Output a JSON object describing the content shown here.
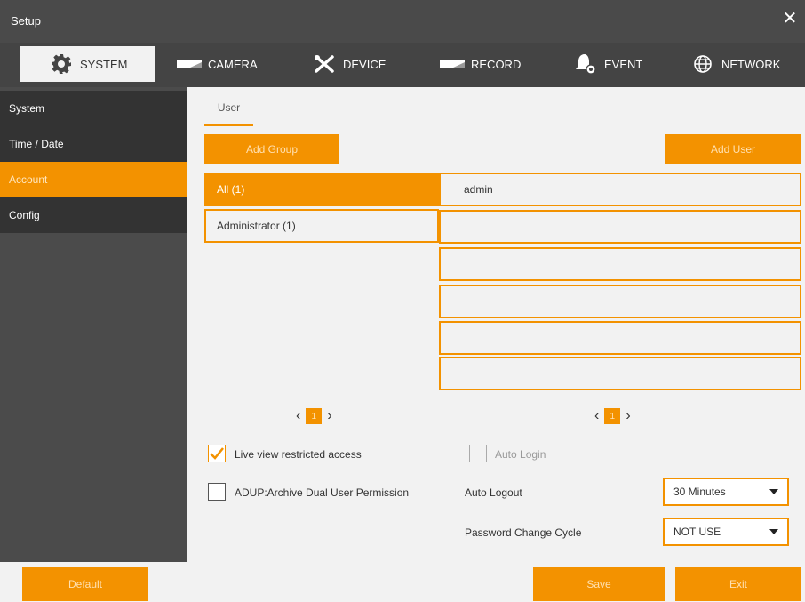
{
  "window": {
    "title": "Setup",
    "close_label": "✕"
  },
  "tabs": [
    {
      "label": "SYSTEM",
      "icon": "gear-icon",
      "active": true
    },
    {
      "label": "CAMERA",
      "icon": "camera-icon",
      "active": false
    },
    {
      "label": "DEVICE",
      "icon": "tools-icon",
      "active": false
    },
    {
      "label": "RECORD",
      "icon": "record-icon",
      "active": false
    },
    {
      "label": "EVENT",
      "icon": "bell-icon",
      "active": false
    },
    {
      "label": "NETWORK",
      "icon": "globe-icon",
      "active": false
    }
  ],
  "sidebar": {
    "items": [
      {
        "label": "System",
        "active": false
      },
      {
        "label": "Time / Date",
        "active": false
      },
      {
        "label": "Account",
        "active": true
      },
      {
        "label": "Config",
        "active": false
      }
    ]
  },
  "main": {
    "subtab": "User",
    "add_group_label": "Add Group",
    "add_user_label": "Add User",
    "groups": [
      {
        "label": "All (1)",
        "selected": true
      },
      {
        "label": "Administrator (1)",
        "selected": false
      }
    ],
    "users": [
      "admin",
      "",
      "",
      "",
      "",
      ""
    ],
    "group_pager": {
      "prev": "‹",
      "page": "1",
      "next": "›"
    },
    "user_pager": {
      "prev": "‹",
      "page": "1",
      "next": "›"
    },
    "live_view_restricted": {
      "label": "Live view restricted access",
      "checked": true
    },
    "adup": {
      "label": "ADUP:Archive Dual User Permission",
      "checked": false
    },
    "auto_login": {
      "label": "Auto Login",
      "checked": false,
      "disabled": true
    },
    "auto_logout": {
      "label": "Auto Logout",
      "value": "30 Minutes"
    },
    "password_change_cycle": {
      "label": "Password Change Cycle",
      "value": "NOT USE"
    }
  },
  "footer": {
    "default_label": "Default",
    "save_label": "Save",
    "exit_label": "Exit"
  },
  "colors": {
    "accent": "#f39200",
    "titlebar": "#4a4a4a",
    "sidebar": "#4b4b4b",
    "panel": "#f2f2f2"
  }
}
